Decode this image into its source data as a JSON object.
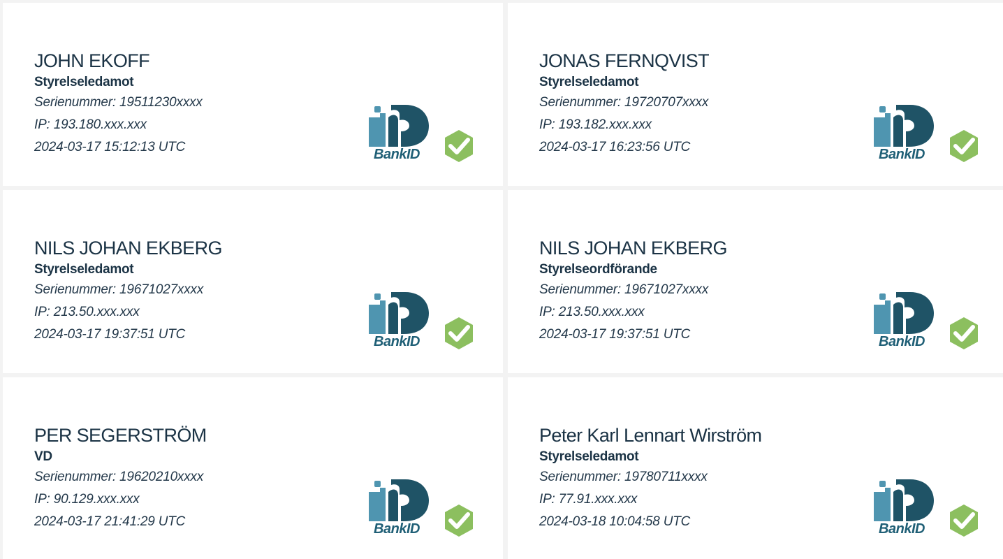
{
  "signatures": [
    {
      "name": "JOHN EKOFF",
      "role": "Styrelseledamot",
      "serial": "Serienummer: 19511230xxxx",
      "ip": "IP: 193.180.xxx.xxx",
      "timestamp": "2024-03-17 15:12:13 UTC"
    },
    {
      "name": "JONAS FERNQVIST",
      "role": "Styrelseledamot",
      "serial": "Serienummer: 19720707xxxx",
      "ip": "IP: 193.182.xxx.xxx",
      "timestamp": "2024-03-17 16:23:56 UTC"
    },
    {
      "name": "NILS JOHAN EKBERG",
      "role": "Styrelseledamot",
      "serial": "Serienummer: 19671027xxxx",
      "ip": "IP: 213.50.xxx.xxx",
      "timestamp": "2024-03-17 19:37:51 UTC"
    },
    {
      "name": "NILS JOHAN EKBERG",
      "role": "Styrelseordförande",
      "serial": "Serienummer: 19671027xxxx",
      "ip": "IP: 213.50.xxx.xxx",
      "timestamp": "2024-03-17 19:37:51 UTC"
    },
    {
      "name": "PER SEGERSTRÖM",
      "role": "VD",
      "serial": "Serienummer: 19620210xxxx",
      "ip": "IP: 90.129.xxx.xxx",
      "timestamp": "2024-03-17 21:41:29 UTC"
    },
    {
      "name": "Peter Karl Lennart Wirström",
      "role": "Styrelseledamot",
      "serial": "Serienummer: 19780711xxxx",
      "ip": "IP: 77.91.xxx.xxx",
      "timestamp": "2024-03-18 10:04:58 UTC"
    }
  ],
  "badge": {
    "logo_text": "BankID",
    "logo_icon": "bankid-logo-icon",
    "verified_icon": "verified-check-icon"
  },
  "colors": {
    "name_text": "#1b3345",
    "bankid_dark": "#1f5366",
    "bankid_light": "#4f95b0",
    "check_green": "#8cbf5f"
  }
}
